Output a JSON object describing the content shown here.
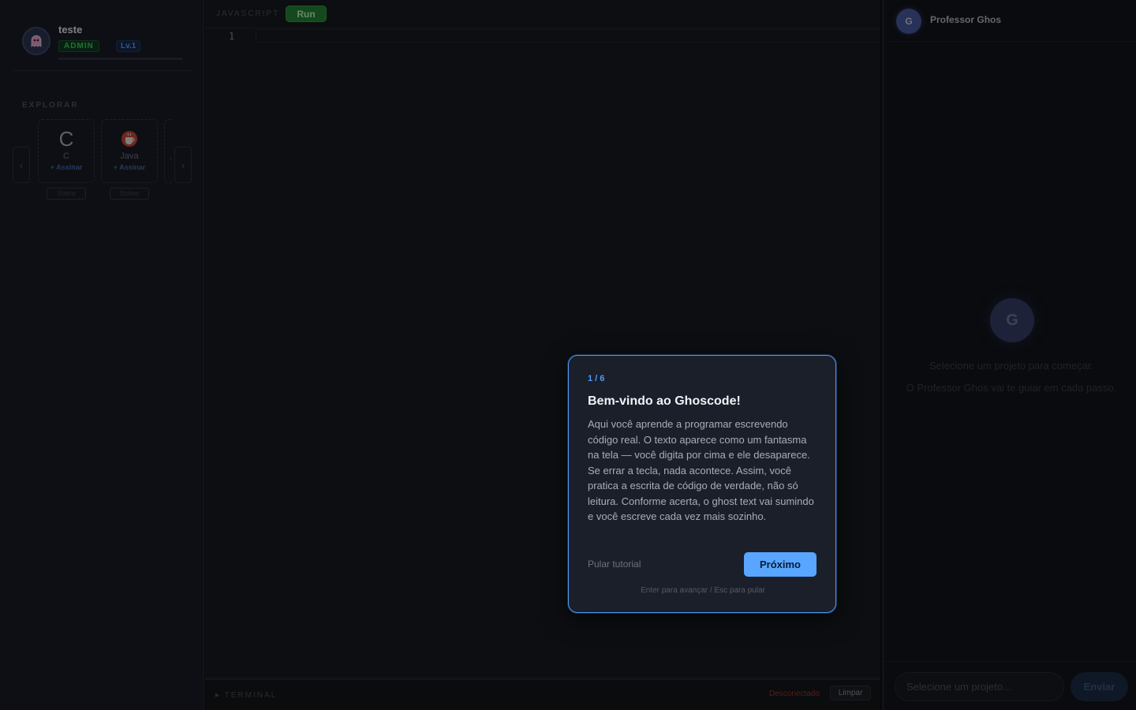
{
  "sidebar": {
    "username": "teste",
    "role_badge": "ADMIN",
    "level_badge": "Lv.1",
    "section_label": "EXPLORAR",
    "prev_label": "‹",
    "next_label": "›",
    "cards": [
      {
        "logo": "C",
        "name": "C",
        "action": "+ Assinar",
        "about": "Sobre"
      },
      {
        "logo": "coffee-cup",
        "name": "Java",
        "action": "+ Assinar",
        "about": "Sobre"
      }
    ],
    "card_edge_label": "‹"
  },
  "editor": {
    "language_label": "JAVASCRIPT",
    "run_label": "Run",
    "line_number": "1"
  },
  "terminal": {
    "label": "▸  TERMINAL",
    "status": "Desconectado",
    "status_color": "#a0322f",
    "clear_label": "Limpar"
  },
  "chat": {
    "avatar_initial": "G",
    "name": "Professor Ghos",
    "empty_title": "Selecione um projeto para começar.",
    "empty_subtitle": "O Professor Ghos vai te guiar em cada passo.",
    "input_placeholder": "Selecione um projeto...",
    "send_label": "Enviar"
  },
  "tutorial": {
    "step": "1 / 6",
    "title": "Bem-vindo ao Ghoscode!",
    "body": "Aqui você aprende a programar escrevendo código real. O texto aparece como um fantasma na tela — você digita por cima e ele desaparece. Se errar a tecla, nada acontece. Assim, você pratica a escrita de código de verdade, não só leitura. Conforme acerta, o ghost text vai sumindo e você escreve cada vez mais sozinho.",
    "skip_label": "Pular tutorial",
    "next_label": "Próximo",
    "hint": "Enter para avançar / Esc para pular"
  },
  "colors": {
    "accent": "#58a6ff",
    "run_green": "#238636",
    "admin_green": "#39d353"
  }
}
